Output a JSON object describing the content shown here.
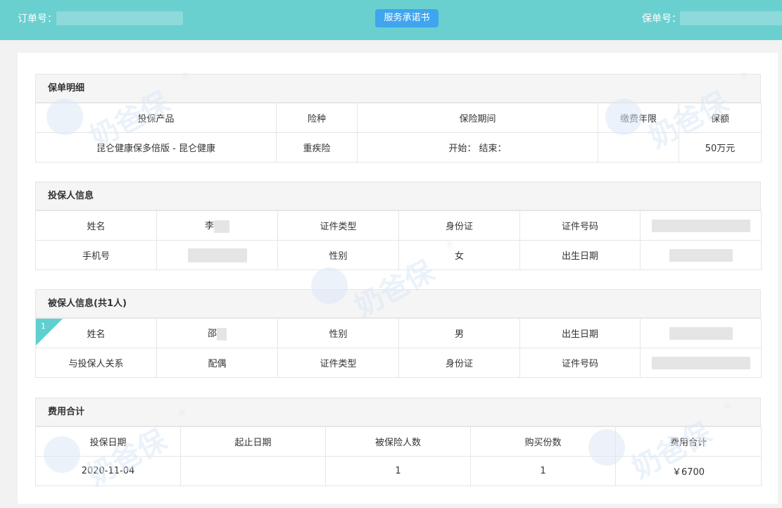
{
  "header": {
    "order_label": "订单号：",
    "promise_button": "服务承诺书",
    "policy_label": "保单号："
  },
  "policy": {
    "title": "保单明细",
    "columns": [
      "投保产品",
      "险种",
      "保险期间",
      "缴费年限",
      "保额"
    ],
    "row": {
      "product": "昆仑健康保多倍版 - 昆仑健康",
      "type": "重疾险",
      "period": "开始：  结束：",
      "pay_years": "",
      "amount": "50万元"
    }
  },
  "applicant": {
    "title": "投保人信息",
    "name_label": "姓名",
    "name_value": "李",
    "id_type_label": "证件类型",
    "id_type_value": "身份证",
    "id_no_label": "证件号码",
    "phone_label": "手机号",
    "gender_label": "性别",
    "gender_value": "女",
    "birth_label": "出生日期"
  },
  "insured": {
    "title": "被保人信息(共1人)",
    "index": "1",
    "name_label": "姓名",
    "name_value": "邵",
    "gender_label": "性别",
    "gender_value": "男",
    "birth_label": "出生日期",
    "relation_label": "与投保人关系",
    "relation_value": "配偶",
    "id_type_label": "证件类型",
    "id_type_value": "身份证",
    "id_no_label": "证件号码"
  },
  "fees": {
    "title": "费用合计",
    "columns": [
      "投保日期",
      "起止日期",
      "被保险人数",
      "购买份数",
      "费用合计"
    ],
    "row": {
      "date": "2020-11-04",
      "range": "",
      "insured_count": "1",
      "copies": "1",
      "total": "￥6700"
    }
  },
  "watermark": {
    "text": "奶爸保",
    "reg": "®"
  },
  "colors": {
    "topbar": "#6acfcf",
    "button": "#3fa5ef",
    "ribbon": "#5fcfcf"
  }
}
